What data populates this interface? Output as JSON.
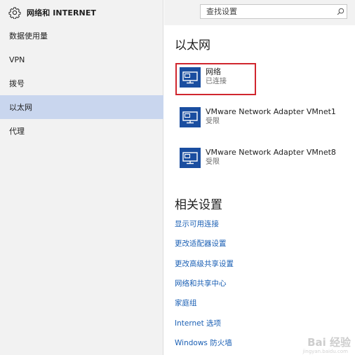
{
  "app": {
    "title": "网络和 INTERNET"
  },
  "search": {
    "placeholder": "查找设置"
  },
  "nav": {
    "items": [
      {
        "label": "数据使用量"
      },
      {
        "label": "VPN"
      },
      {
        "label": "拨号"
      },
      {
        "label": "以太网",
        "selected": true
      },
      {
        "label": "代理"
      }
    ]
  },
  "main": {
    "section_title": "以太网",
    "networks": [
      {
        "name": "网络",
        "status": "已连接"
      },
      {
        "name": "VMware Network Adapter VMnet1",
        "status": "受限"
      },
      {
        "name": "VMware Network Adapter VMnet8",
        "status": "受限"
      }
    ],
    "related": {
      "title": "相关设置",
      "links": [
        "显示可用连接",
        "更改适配器设置",
        "更改高级共享设置",
        "网络和共享中心",
        "家庭组",
        "Internet 选项",
        "Windows 防火墙"
      ]
    }
  },
  "watermark": {
    "text": "Bai 经验",
    "sub": "jingyan.baidu.com"
  },
  "colors": {
    "accent": "#1a4ea0",
    "link": "#1a5fb4",
    "selected_bg": "#c9d6ee",
    "highlight": "#d0262e"
  },
  "icons": {
    "settings": "gear-icon",
    "search": "search-icon",
    "network": "ethernet-monitor-icon"
  }
}
